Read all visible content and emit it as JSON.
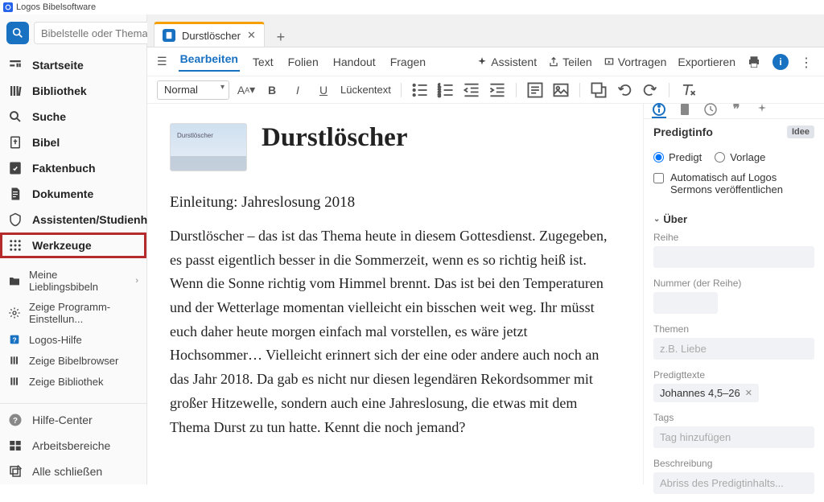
{
  "app": {
    "title": "Logos Bibelsoftware"
  },
  "sidebar": {
    "search_placeholder": "Bibelstelle oder Thema",
    "items": [
      {
        "label": "Startseite"
      },
      {
        "label": "Bibliothek"
      },
      {
        "label": "Suche"
      },
      {
        "label": "Bibel"
      },
      {
        "label": "Faktenbuch"
      },
      {
        "label": "Dokumente"
      },
      {
        "label": "Assistenten/Studienhilfen"
      },
      {
        "label": "Werkzeuge"
      }
    ],
    "sub_items": [
      {
        "label": "Meine Lieblingsbibeln"
      },
      {
        "label": "Zeige Programm-Einstellun..."
      },
      {
        "label": "Logos-Hilfe"
      },
      {
        "label": "Zeige Bibelbrowser"
      },
      {
        "label": "Zeige Bibliothek"
      }
    ],
    "bottom_items": [
      {
        "label": "Hilfe-Center"
      },
      {
        "label": "Arbeitsbereiche"
      },
      {
        "label": "Alle schließen"
      }
    ]
  },
  "tabs": {
    "active_label": "Durstlöscher"
  },
  "doc_toolbar": {
    "tabs": [
      "Bearbeiten",
      "Text",
      "Folien",
      "Handout",
      "Fragen"
    ],
    "assistant": "Assistent",
    "share": "Teilen",
    "present": "Vortragen",
    "export": "Exportieren"
  },
  "format_toolbar": {
    "style": "Normal",
    "fill_text": "Lückentext"
  },
  "document": {
    "thumb_label": "Durstlöscher",
    "title": "Durstlöscher",
    "subtitle": "Einleitung: Jahreslosung 2018",
    "body": "Durstlöscher – das ist das Thema heute in diesem Gottesdienst. Zugegeben, es passt eigentlich besser in die Sommerzeit, wenn es so richtig heiß ist. Wenn die Sonne richtig vom Himmel brennt. Das ist bei den Temperaturen und der Wetterlage momentan vielleicht ein bisschen weit weg. Ihr müsst euch daher heute morgen einfach mal vorstellen, es wäre jetzt Hochsommer… Vielleicht erinnert sich der eine oder andere auch noch an das Jahr 2018. Da gab es nicht nur diesen legendären Rekordsommer mit großer Hitzewelle, sondern auch eine Jahreslosung, die etwas mit dem Thema Durst zu tun hatte. Kennt die noch jemand?"
  },
  "right_panel": {
    "header": "Predigtinfo",
    "badge": "Idee",
    "radio_sermon": "Predigt",
    "radio_template": "Vorlage",
    "auto_publish": "Automatisch auf Logos Sermons veröffentlichen",
    "about_section": "Über",
    "series_label": "Reihe",
    "number_label": "Nummer (der Reihe)",
    "topics_label": "Themen",
    "topics_placeholder": "z.B. Liebe",
    "texts_label": "Predigttexte",
    "text_chip": "Johannes 4,5–26",
    "tags_label": "Tags",
    "tags_placeholder": "Tag hinzufügen",
    "description_label": "Beschreibung",
    "description_placeholder": "Abriss des Predigtinhalts..."
  }
}
